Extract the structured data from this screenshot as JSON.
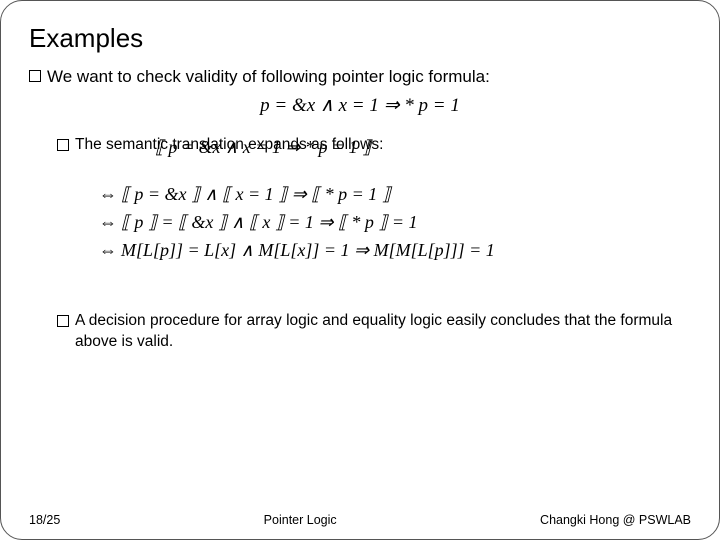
{
  "title": "Examples",
  "bullet1": "We want to check validity of following pointer logic formula:",
  "formula_main": "p = &x ∧ x = 1 ⇒ * p = 1",
  "bullet2": "The semantic translation expands as follows:",
  "derivation": {
    "line1": "⟦ p = &x ∧ x = 1 ⇒ * p = 1 ⟧",
    "line2_lead": "⇔",
    "line2": "⟦ p = &x ⟧ ∧ ⟦ x = 1 ⟧ ⇒ ⟦ * p = 1 ⟧",
    "line3_lead": "⇔",
    "line3": "⟦ p ⟧ = ⟦ &x ⟧ ∧ ⟦ x ⟧ = 1 ⇒ ⟦ * p ⟧ = 1",
    "line4_lead": "⇔",
    "line4": "M[L[p]] = L[x] ∧ M[L[x]] = 1 ⇒ M[M[L[p]]] = 1"
  },
  "bullet3": "A decision procedure for array logic and equality logic easily concludes that the formula above is valid.",
  "footer": {
    "left": "18/25",
    "center": "Pointer Logic",
    "right": "Changki Hong @ PSWLAB"
  }
}
